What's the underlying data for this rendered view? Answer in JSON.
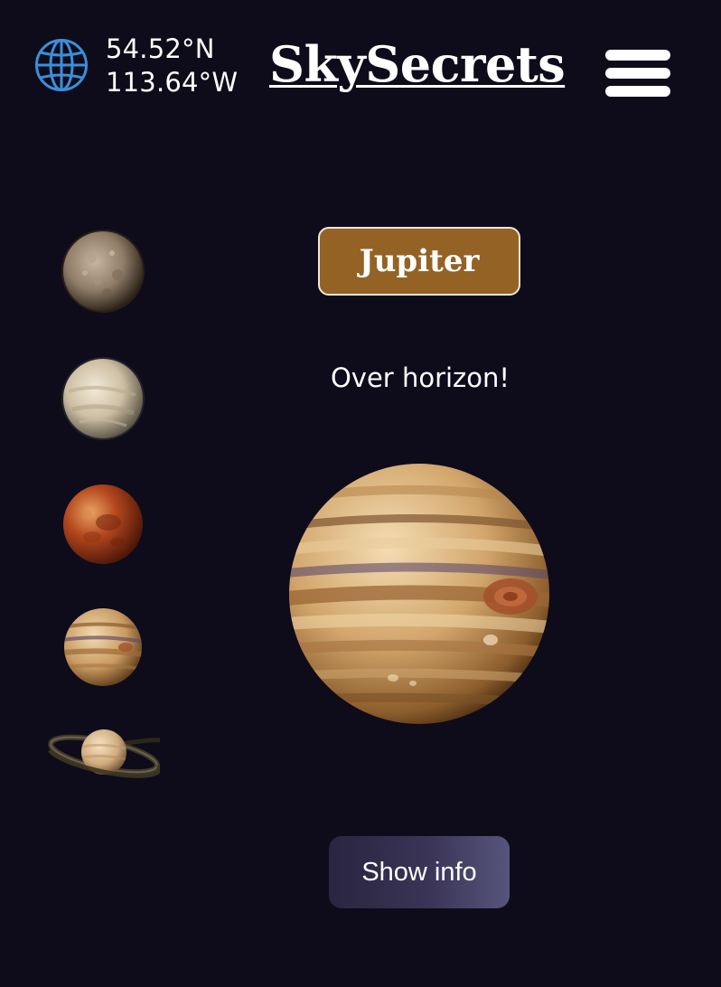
{
  "header": {
    "globe_icon": "globe-icon",
    "latitude": "54.52°N",
    "longitude": "113.64°W",
    "app_title": "SkySecrets",
    "menu_icon": "hamburger-menu-icon"
  },
  "planets": [
    {
      "name": "Mercury",
      "icon": "mercury-icon"
    },
    {
      "name": "Venus",
      "icon": "venus-icon"
    },
    {
      "name": "Mars",
      "icon": "mars-icon"
    },
    {
      "name": "Jupiter",
      "icon": "jupiter-icon"
    },
    {
      "name": "Saturn",
      "icon": "saturn-icon"
    }
  ],
  "selected": {
    "name": "Jupiter",
    "status": "Over horizon!"
  },
  "actions": {
    "show_info_label": "Show info"
  },
  "colors": {
    "background": "#0e0c1b",
    "accent_button": "#946225",
    "globe": "#3b8fd9"
  }
}
